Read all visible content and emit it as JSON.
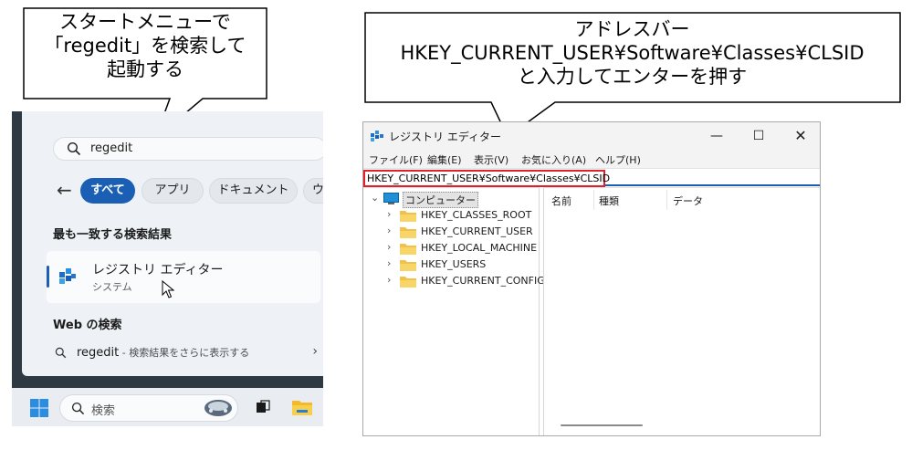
{
  "callouts": {
    "start_menu": [
      "スタートメニューで",
      "「regedit」を検索して",
      "起動する"
    ],
    "address_bar": [
      "アドレスバー",
      "HKEY_CURRENT_USER¥Software¥Classes¥CLSID",
      "と入力してエンターを押す"
    ]
  },
  "start_menu": {
    "search_query": "regedit",
    "back_icon": "arrow-left-icon",
    "chips": [
      "すべて",
      "アプリ",
      "ドキュメント",
      "ウェ"
    ],
    "best_match_title": "最も一致する検索結果",
    "best_match": {
      "name": "レジストリ エディター",
      "type": "システム",
      "icon": "registry-editor-icon"
    },
    "web_title": "Web の検索",
    "web_result": {
      "query": "regedit",
      "hint": " - 検索結果をさらに表示する",
      "icon": "search-icon"
    },
    "accent_color": "#1a5fb4"
  },
  "taskbar": {
    "search_placeholder": "検索",
    "icons": [
      "windows-start-icon",
      "search-icon",
      "search-highlight-icon",
      "task-view-icon",
      "file-explorer-icon"
    ]
  },
  "regedit": {
    "title": "レジストリ エディター",
    "window_buttons": {
      "minimize": "—",
      "maximize": "☐",
      "close": "✕"
    },
    "menu": [
      "ファイル(F)",
      "編集(E)",
      "表示(V)",
      "お気に入り(A)",
      "ヘルプ(H)"
    ],
    "address": "HKEY_CURRENT_USER¥Software¥Classes¥CLSID",
    "tree_root": "コンピューター",
    "tree_items": [
      "HKEY_CLASSES_ROOT",
      "HKEY_CURRENT_USER",
      "HKEY_LOCAL_MACHINE",
      "HKEY_USERS",
      "HKEY_CURRENT_CONFIG"
    ],
    "columns": [
      "名前",
      "種類",
      "データ"
    ],
    "highlight_color": "#e0202a"
  }
}
